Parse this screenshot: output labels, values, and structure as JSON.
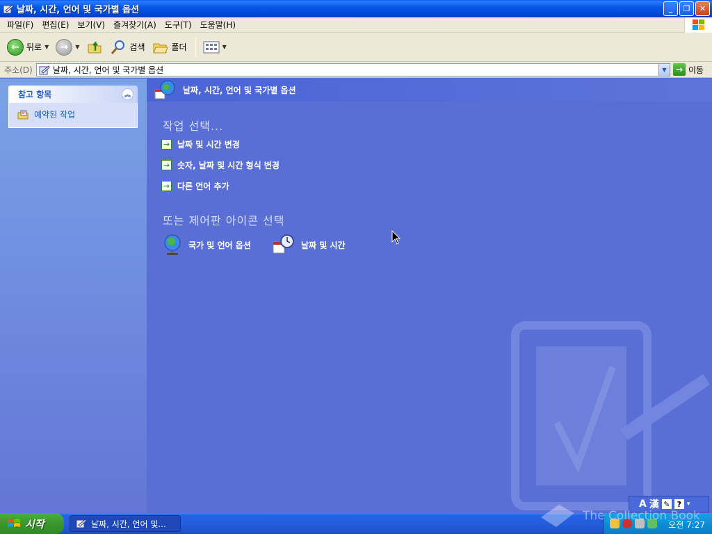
{
  "window": {
    "title": "날짜, 시간, 언어 및 국가별 옵션"
  },
  "menu": {
    "items": [
      "파일(F)",
      "편집(E)",
      "보기(V)",
      "즐겨찾기(A)",
      "도구(T)",
      "도움말(H)"
    ]
  },
  "toolbar": {
    "back_label": "뒤로",
    "search_label": "검색",
    "folders_label": "폴더"
  },
  "address": {
    "label": "주소(D)",
    "value": "날짜, 시간, 언어 및 국가별 옵션",
    "go_label": "이동"
  },
  "sidebar": {
    "panel_title": "참고 항목",
    "links": [
      "예약된 작업"
    ]
  },
  "main": {
    "header_title": "날짜, 시간, 언어 및 국가별 옵션",
    "pick_task_title": "작업 선택...",
    "tasks": [
      "날짜 및 시간 변경",
      "숫자, 날짜 및 시간 형식 변경",
      "다른 언어 추가"
    ],
    "pick_icon_title": "또는 제어판 아이콘 선택",
    "icons": [
      "국가 및 언어 옵션",
      "날짜 및 시간"
    ]
  },
  "langbar": {
    "mode": "A",
    "hanja": "漢"
  },
  "taskbar": {
    "start_label": "시작",
    "window_button": "날짜, 시간, 언어 및...",
    "clock": "오전 7:27",
    "watermark": "The Collection Book"
  },
  "colors": {
    "title_blue": "#0054e3",
    "main_bg": "#5a6fd6",
    "link_blue": "#215dc6",
    "start_green": "#3c9a30"
  }
}
